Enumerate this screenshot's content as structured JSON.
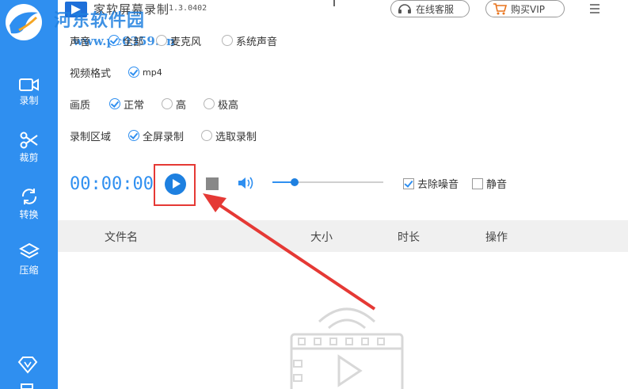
{
  "header": {
    "title": "家软屏幕录制",
    "version": "1.3.0402",
    "online_service": "在线客服",
    "buy_vip": "购买VIP"
  },
  "watermark": {
    "site_name": "河东软件园",
    "url": "www.pc0359.cn"
  },
  "sidebar": {
    "items": [
      {
        "label": "录制",
        "icon": "video-camera-icon"
      },
      {
        "label": "裁剪",
        "icon": "scissors-icon"
      },
      {
        "label": "转换",
        "icon": "convert-icon"
      },
      {
        "label": "压缩",
        "icon": "layers-icon"
      }
    ]
  },
  "settings": {
    "audio": {
      "label": "声音",
      "options": [
        "全部",
        "麦克风",
        "系统声音"
      ],
      "selected": "全部"
    },
    "format": {
      "label": "视频格式",
      "options": [
        "mp4"
      ],
      "selected": "mp4"
    },
    "quality": {
      "label": "画质",
      "options": [
        "正常",
        "高",
        "极高"
      ],
      "selected": "正常"
    },
    "area": {
      "label": "录制区域",
      "options": [
        "全屏录制",
        "选取录制"
      ],
      "selected": "全屏录制"
    }
  },
  "controls": {
    "timer": "00:00:00",
    "volume_level": 0.2,
    "denoise": {
      "label": "去除噪音",
      "checked": true
    },
    "mute": {
      "label": "静音",
      "checked": false
    }
  },
  "table": {
    "columns": [
      "文件名",
      "大小",
      "时长",
      "操作"
    ]
  },
  "colors": {
    "accent": "#2f8ff0",
    "highlight": "#e53935"
  }
}
